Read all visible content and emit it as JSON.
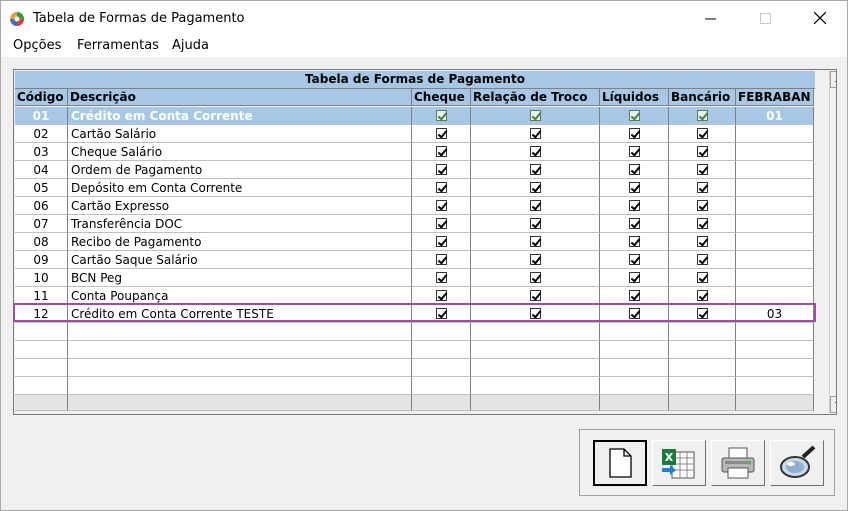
{
  "window": {
    "title": "Tabela de Formas de Pagamento"
  },
  "menu": [
    "Opções",
    "Ferramentas",
    "Ajuda"
  ],
  "grid": {
    "title": "Tabela de Formas de Pagamento",
    "columns": [
      "Código",
      "Descrição",
      "Cheque",
      "Relação de Troco",
      "Líquidos",
      "Bancário",
      "FEBRABAN"
    ],
    "rows": [
      {
        "code": "01",
        "desc": "Crédito em Conta Corrente",
        "cheque": true,
        "troco": true,
        "liquidos": true,
        "bancario": true,
        "febraban": "01",
        "selected": true
      },
      {
        "code": "02",
        "desc": "Cartão Salário",
        "cheque": true,
        "troco": true,
        "liquidos": true,
        "bancario": true,
        "febraban": ""
      },
      {
        "code": "03",
        "desc": "Cheque Salário",
        "cheque": true,
        "troco": true,
        "liquidos": true,
        "bancario": true,
        "febraban": ""
      },
      {
        "code": "04",
        "desc": "Ordem de Pagamento",
        "cheque": true,
        "troco": true,
        "liquidos": true,
        "bancario": true,
        "febraban": ""
      },
      {
        "code": "05",
        "desc": "Depósito em Conta Corrente",
        "cheque": true,
        "troco": true,
        "liquidos": true,
        "bancario": true,
        "febraban": ""
      },
      {
        "code": "06",
        "desc": "Cartão Expresso",
        "cheque": true,
        "troco": true,
        "liquidos": true,
        "bancario": true,
        "febraban": ""
      },
      {
        "code": "07",
        "desc": "Transferência DOC",
        "cheque": true,
        "troco": true,
        "liquidos": true,
        "bancario": true,
        "febraban": ""
      },
      {
        "code": "08",
        "desc": "Recibo de Pagamento",
        "cheque": true,
        "troco": true,
        "liquidos": true,
        "bancario": true,
        "febraban": ""
      },
      {
        "code": "09",
        "desc": "Cartão Saque Salário",
        "cheque": true,
        "troco": true,
        "liquidos": true,
        "bancario": true,
        "febraban": ""
      },
      {
        "code": "10",
        "desc": "BCN Peg",
        "cheque": true,
        "troco": true,
        "liquidos": true,
        "bancario": true,
        "febraban": ""
      },
      {
        "code": "11",
        "desc": "Conta Poupança",
        "cheque": true,
        "troco": true,
        "liquidos": true,
        "bancario": true,
        "febraban": ""
      },
      {
        "code": "12",
        "desc": "Crédito em Conta Corrente TESTE",
        "cheque": true,
        "troco": true,
        "liquidos": true,
        "bancario": true,
        "febraban": "03",
        "highlighted": true
      }
    ],
    "empty_rows": 4
  },
  "toolbar": [
    {
      "name": "new-document-icon"
    },
    {
      "name": "excel-export-icon"
    },
    {
      "name": "printer-icon"
    },
    {
      "name": "magnifier-icon"
    }
  ],
  "colors": {
    "header": "#a6c8e6",
    "highlight_border": "#9b4fa0"
  }
}
